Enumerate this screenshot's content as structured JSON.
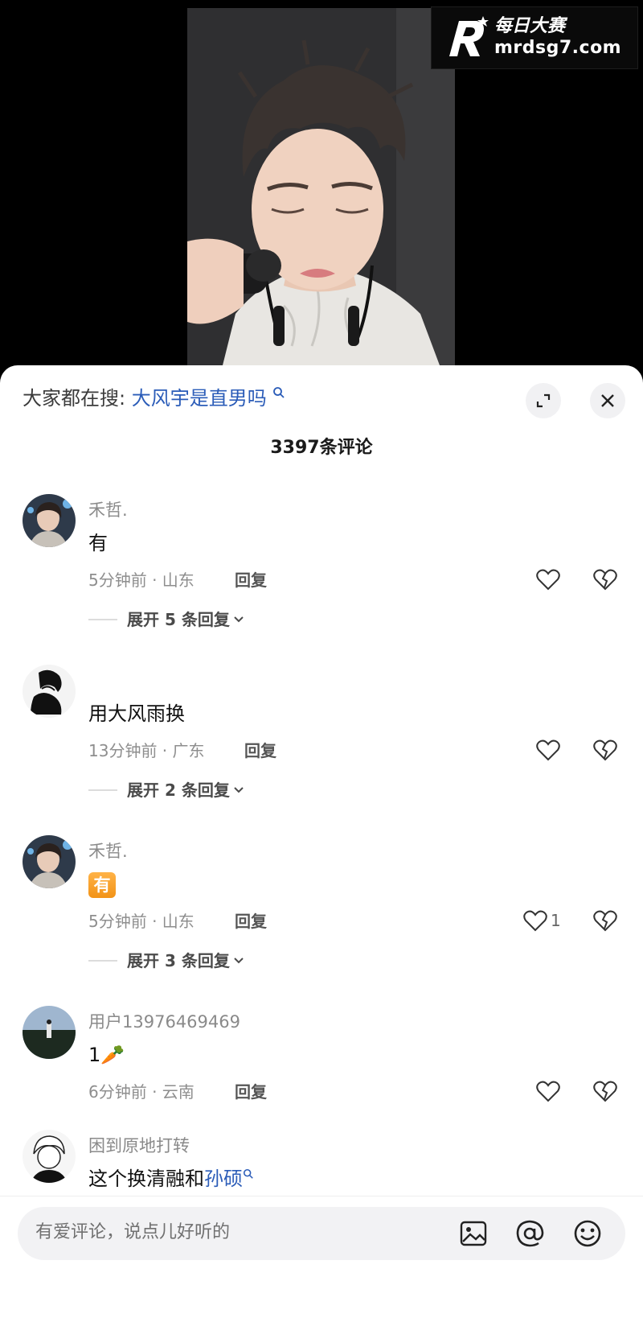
{
  "watermark": {
    "brand": "每日大赛",
    "url": "mrdsg7.com"
  },
  "sheet": {
    "search_prefix": "大家都在搜:",
    "search_term": "大风宇是直男吗",
    "comment_count_title": "3397条评论"
  },
  "comments": [
    {
      "username": "禾哲.",
      "content": "有",
      "time_location": "5分钟前 · 山东",
      "reply_label": "回复",
      "likes": "",
      "expand_label": "展开 5 条回复"
    },
    {
      "username": "",
      "content": "用大风雨换",
      "time_location": "13分钟前 · 广东",
      "reply_label": "回复",
      "likes": "",
      "expand_label": "展开 2 条回复"
    },
    {
      "username": "禾哲.",
      "content": "有",
      "time_location": "5分钟前 · 山东",
      "reply_label": "回复",
      "likes": "1",
      "expand_label": "展开 3 条回复"
    },
    {
      "username": "用户13976469469",
      "content": "1🥕",
      "time_location": "6分钟前 · 云南",
      "reply_label": "回复",
      "likes": ""
    },
    {
      "username": "困到原地打转",
      "content_prefix": "这个换清融和",
      "content_link": "孙硕"
    }
  ],
  "input": {
    "placeholder": "有爱评论，说点儿好听的"
  },
  "icons": {
    "expand": "expand-icon",
    "close": "close-icon",
    "like": "heart-outline-icon",
    "dislike": "broken-heart-icon",
    "image": "image-icon",
    "mention": "at-icon",
    "emoji": "emoji-icon",
    "search": "search-icon"
  },
  "colors": {
    "link": "#2b5cb8",
    "badge": "#f29317"
  }
}
